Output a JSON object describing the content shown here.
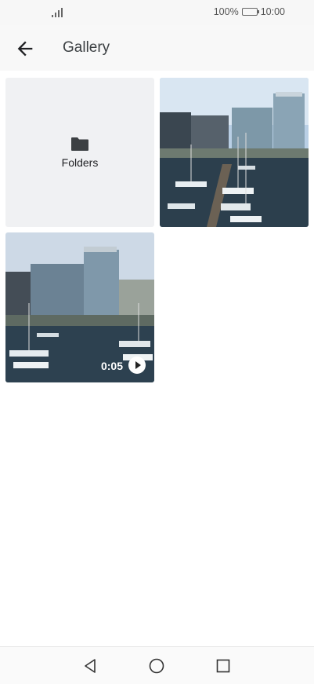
{
  "status_bar": {
    "battery": "100%",
    "time": "10:00",
    "icons": [
      "signal-icon",
      "battery-icon"
    ]
  },
  "app_bar": {
    "title": "Gallery",
    "back_icon": "arrow-back-icon"
  },
  "grid": {
    "folders_label": "Folders",
    "folder_icon": "folder-icon",
    "video_duration": "0:05",
    "play_icon": "play-icon"
  },
  "nav_bar": {
    "icons": [
      "back-triangle-icon",
      "home-circle-icon",
      "recents-square-icon"
    ]
  },
  "colors": {
    "appbar_bg": "#f8f8f8",
    "tile_bg": "#f0f1f3",
    "text": "#202124"
  }
}
